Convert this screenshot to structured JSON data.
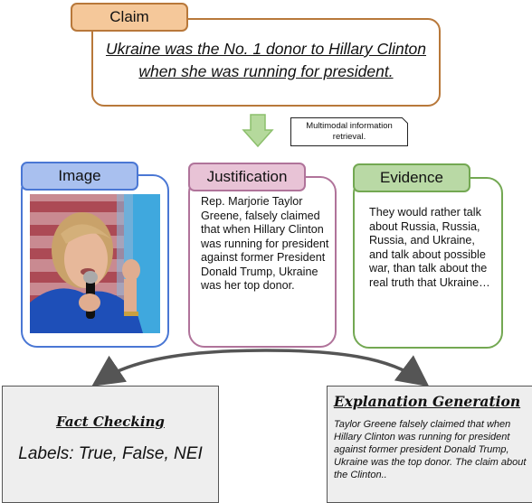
{
  "claim": {
    "tab_label": "Claim",
    "text": "Ukraine was the No. 1 donor to Hillary Clinton when she was running for president."
  },
  "retrieval": {
    "note": "Multimodal information retrieval."
  },
  "panels": {
    "image": {
      "tab_label": "Image",
      "alt": "Photo of Hillary Clinton speaking into a microphone, wearing a blue jacket, in front of an American flag"
    },
    "justification": {
      "tab_label": "Justification",
      "text": "Rep. Marjorie Taylor Greene, falsely claimed that when Hillary Clinton was running for president against former President Donald Trump, Ukraine was her top donor."
    },
    "evidence": {
      "tab_label": "Evidence",
      "text": "They would rather talk about Russia, Russia, Russia, and Ukraine, and talk about possible war, than talk about the real truth that Ukraine…"
    }
  },
  "outputs": {
    "fact_checking": {
      "title": "Fact Checking",
      "labels_text": "Labels: True, False, NEI"
    },
    "explanation": {
      "title": "Explanation Generation",
      "text": "Taylor Greene falsely claimed that when Hillary Clinton was running for president against former president Donald Trump, Ukraine was the top donor. The claim about the Clinton.."
    }
  },
  "colors": {
    "claim": "#b8783a",
    "image": "#4a77d4",
    "justification": "#b0739a",
    "evidence": "#73a852",
    "arrow_green": "#9fc97f",
    "connector": "#555555"
  }
}
